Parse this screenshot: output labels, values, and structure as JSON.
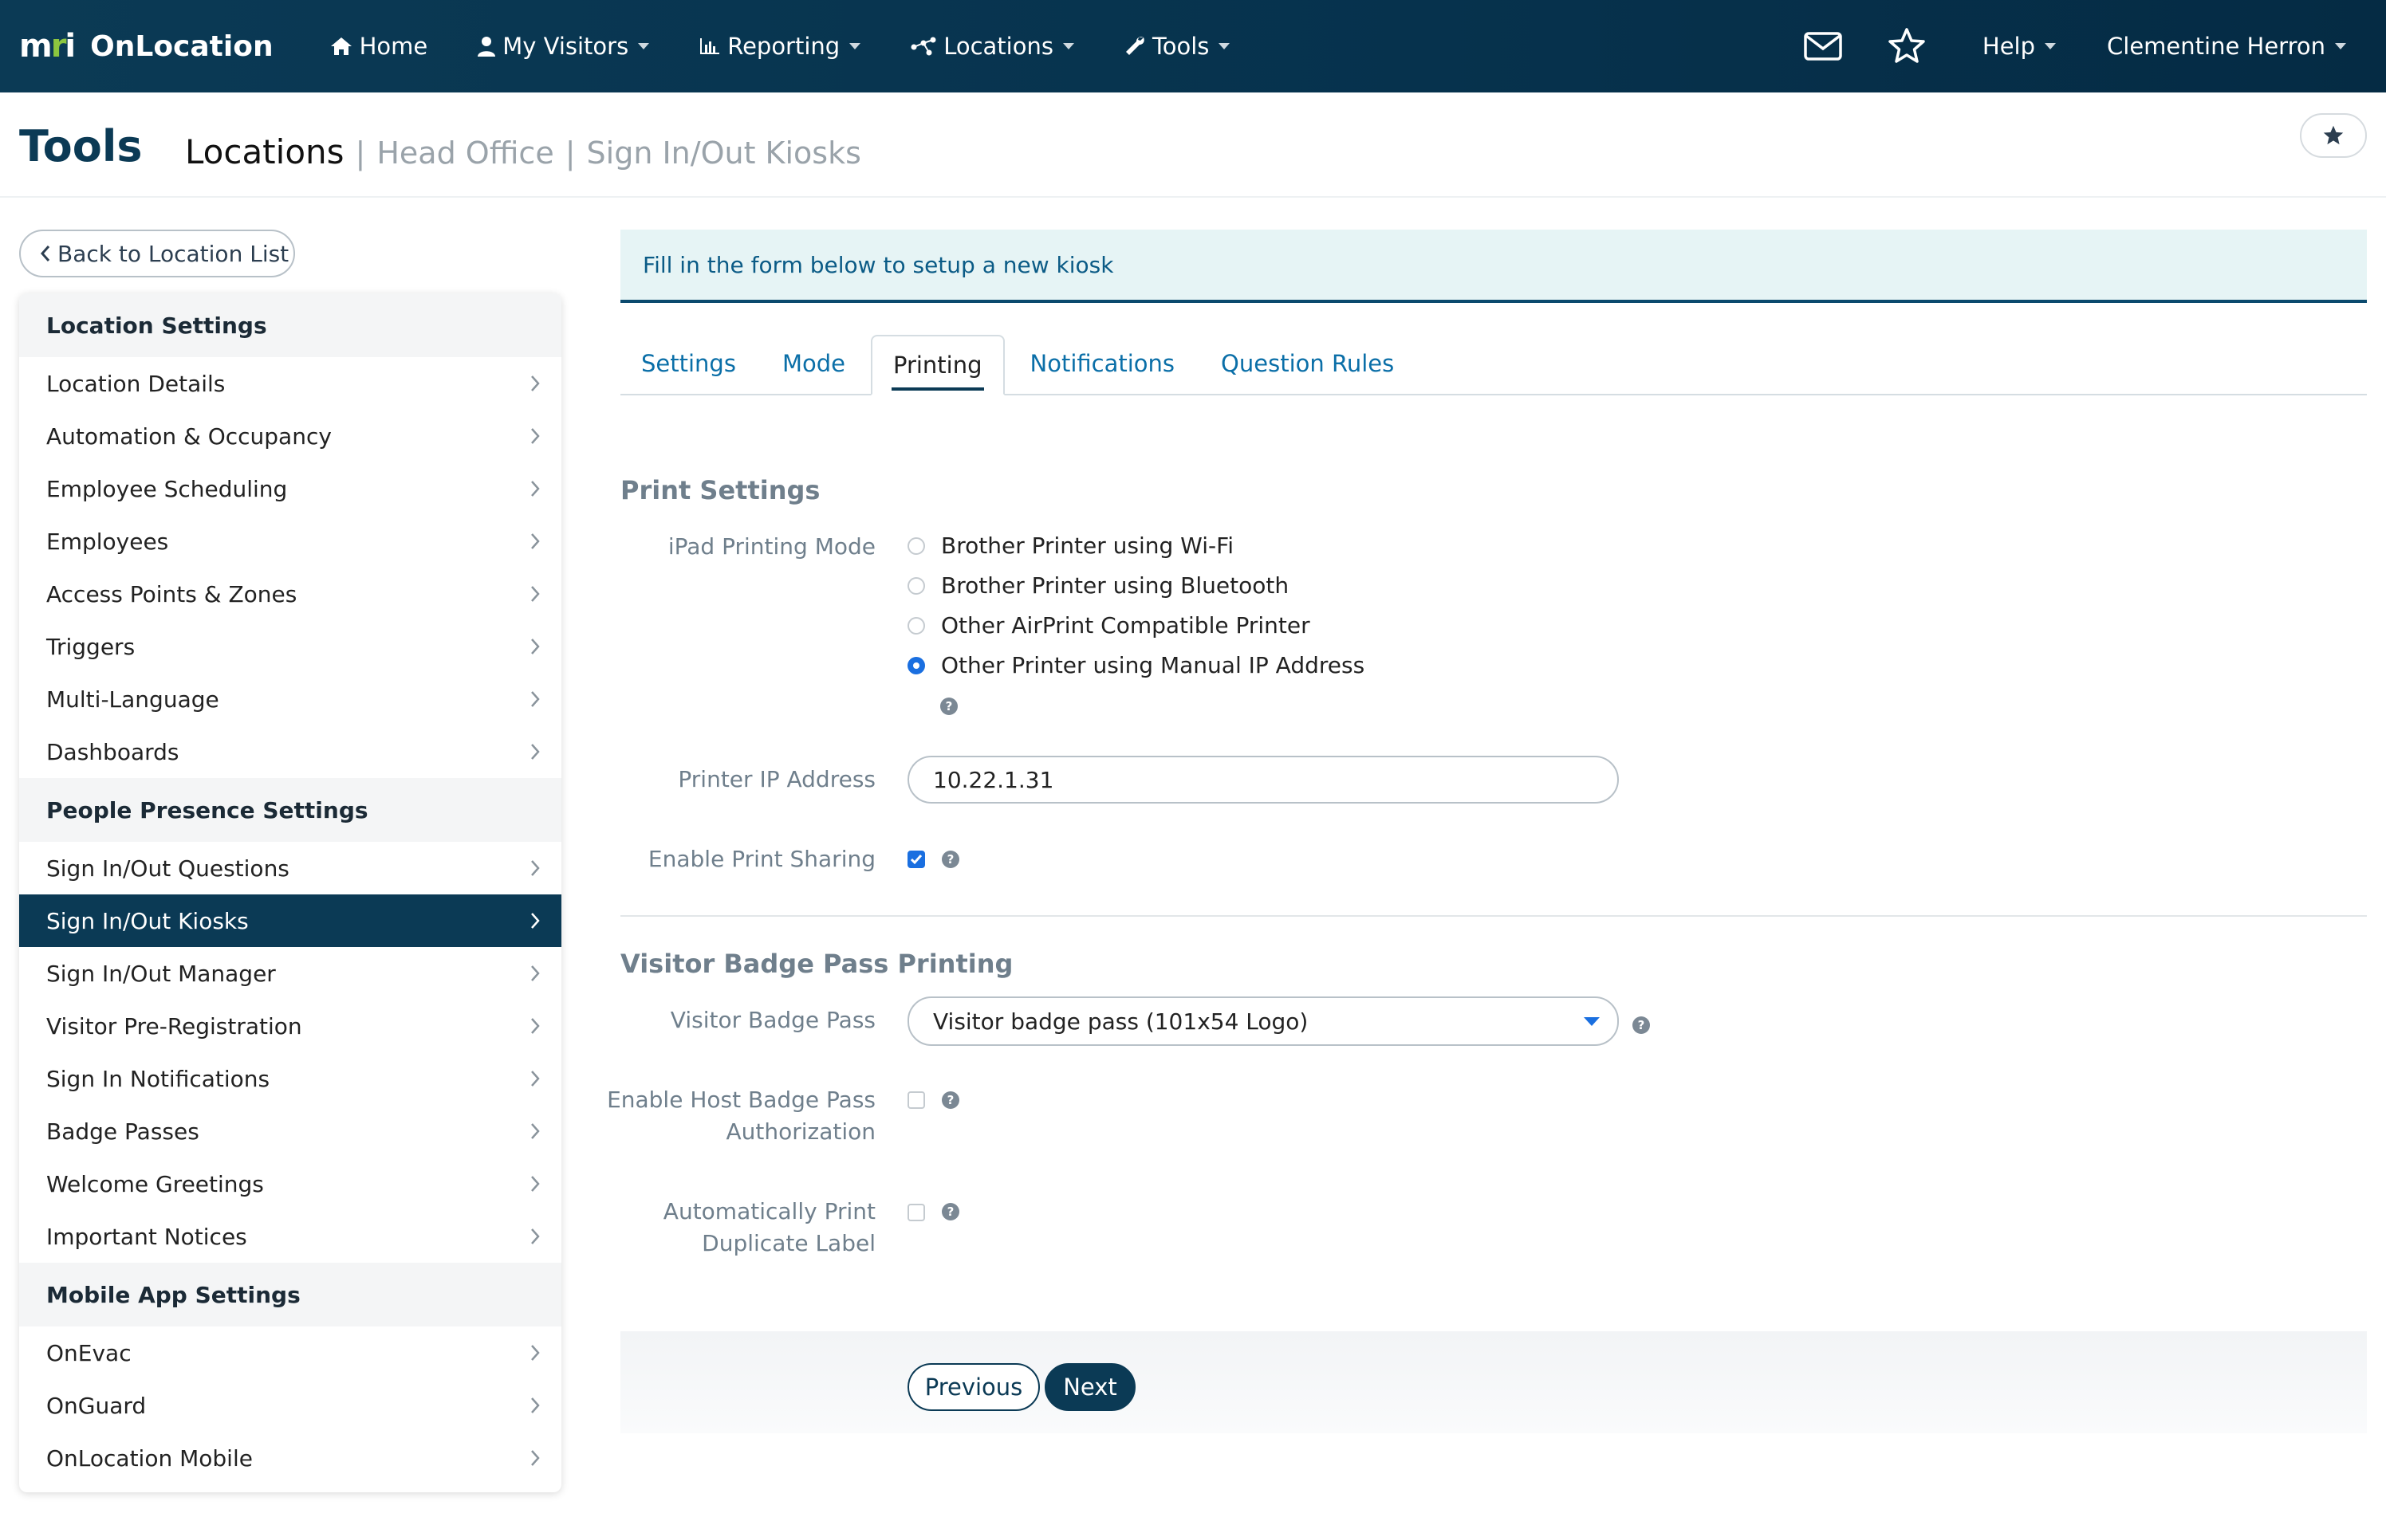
{
  "brand": {
    "logo_m": "m",
    "logo_r": "r",
    "logo_i": "i",
    "name": "OnLocation"
  },
  "nav": {
    "home": "Home",
    "my_visitors": "My Visitors",
    "reporting": "Reporting",
    "locations": "Locations",
    "tools": "Tools",
    "help": "Help",
    "user": "Clementine Herron"
  },
  "header": {
    "title": "Tools",
    "breadcrumb": {
      "current": "Locations",
      "sep1": "|",
      "crumb1": "Head Office",
      "sep2": "|",
      "crumb2": "Sign In/Out Kiosks"
    }
  },
  "sidebar": {
    "back_label": "Back to Location List",
    "groups": [
      {
        "title": "Location Settings",
        "items": [
          "Location Details",
          "Automation & Occupancy",
          "Employee Scheduling",
          "Employees",
          "Access Points & Zones",
          "Triggers",
          "Multi-Language",
          "Dashboards"
        ]
      },
      {
        "title": "People Presence Settings",
        "items": [
          "Sign In/Out Questions",
          "Sign In/Out Kiosks",
          "Sign In/Out Manager",
          "Visitor Pre-Registration",
          "Sign In Notifications",
          "Badge Passes",
          "Welcome Greetings",
          "Important Notices"
        ]
      },
      {
        "title": "Mobile App Settings",
        "items": [
          "OnEvac",
          "OnGuard",
          "OnLocation Mobile"
        ]
      }
    ],
    "active_item": "Sign In/Out Kiosks"
  },
  "main": {
    "banner": "Fill in the form below to setup a new kiosk",
    "tabs": [
      "Settings",
      "Mode",
      "Printing",
      "Notifications",
      "Question Rules"
    ],
    "active_tab": "Printing",
    "print_settings": {
      "title": "Print Settings",
      "mode_label": "iPad Printing Mode",
      "mode_options": [
        "Brother Printer using Wi-Fi",
        "Brother Printer using Bluetooth",
        "Other AirPrint Compatible Printer",
        "Other Printer using Manual IP Address"
      ],
      "mode_selected_index": 3,
      "ip_label": "Printer IP Address",
      "ip_value": "10.22.1.31",
      "sharing_label": "Enable Print Sharing",
      "sharing_checked": true
    },
    "badge_printing": {
      "title": "Visitor Badge Pass Printing",
      "pass_label": "Visitor Badge Pass",
      "pass_value": "Visitor badge pass (101x54 Logo)",
      "host_auth_label_1": "Enable Host Badge Pass",
      "host_auth_label_2": "Authorization",
      "host_auth_checked": false,
      "dup_label_1": "Automatically Print",
      "dup_label_2": "Duplicate Label",
      "dup_checked": false
    },
    "buttons": {
      "previous": "Previous",
      "next": "Next"
    }
  },
  "colors": {
    "nav_bg": "#0b3a55",
    "accent": "#1a6fe0",
    "link": "#0b6fa8",
    "banner_bg": "#e6f4f5"
  },
  "icons": [
    "home-icon",
    "user-icon",
    "bar-chart-icon",
    "network-icon",
    "wrench-icon",
    "mail-icon",
    "star-icon",
    "chevron-left-icon",
    "chevron-right-icon",
    "help-icon"
  ]
}
